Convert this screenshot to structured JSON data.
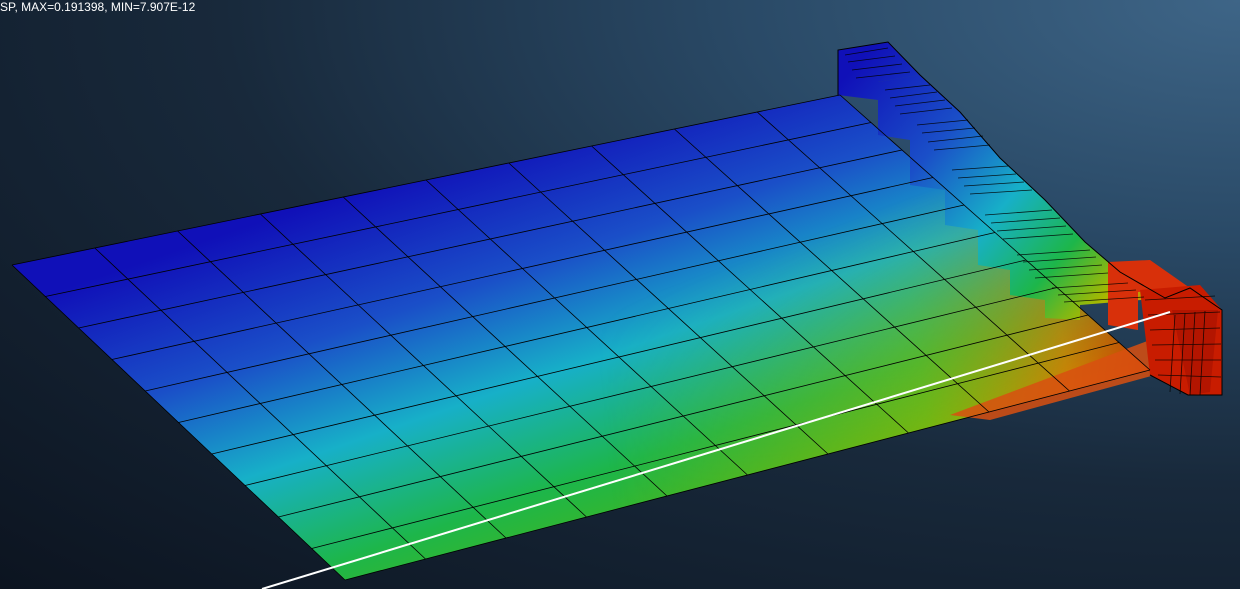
{
  "viewport": {
    "background_colors": [
      "#3e6587",
      "#2a4a67",
      "#18293b",
      "#0c1420"
    ],
    "caption": "SP, MAX=0.191398, MIN=7.907E-12"
  },
  "plot": {
    "model": "plate-with-stepped-flange-mesh",
    "colormap": [
      "#1010b8",
      "#1a4fc8",
      "#17b0c8",
      "#1db64a",
      "#44b51a",
      "#a8b800",
      "#e07a00",
      "#c81c00"
    ],
    "mesh_line_color": "#000000",
    "path_line_color": "#ffffff"
  }
}
